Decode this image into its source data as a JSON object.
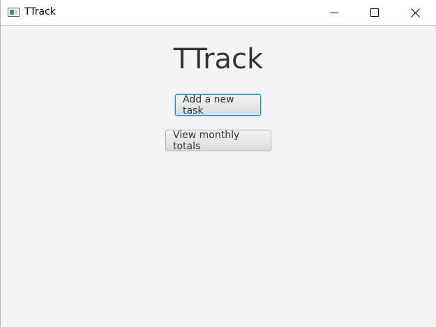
{
  "window": {
    "title": "TTrack",
    "icon": "app-window-icon",
    "controls": [
      "minimize-icon",
      "maximize-icon",
      "close-icon"
    ]
  },
  "main": {
    "heading": "TTrack",
    "buttons": {
      "add_task": "Add a new task",
      "view_totals": "View monthly totals"
    }
  },
  "colors": {
    "background": "#f4f4f4",
    "focus_ring": "#039ed3",
    "text": "#333333"
  }
}
